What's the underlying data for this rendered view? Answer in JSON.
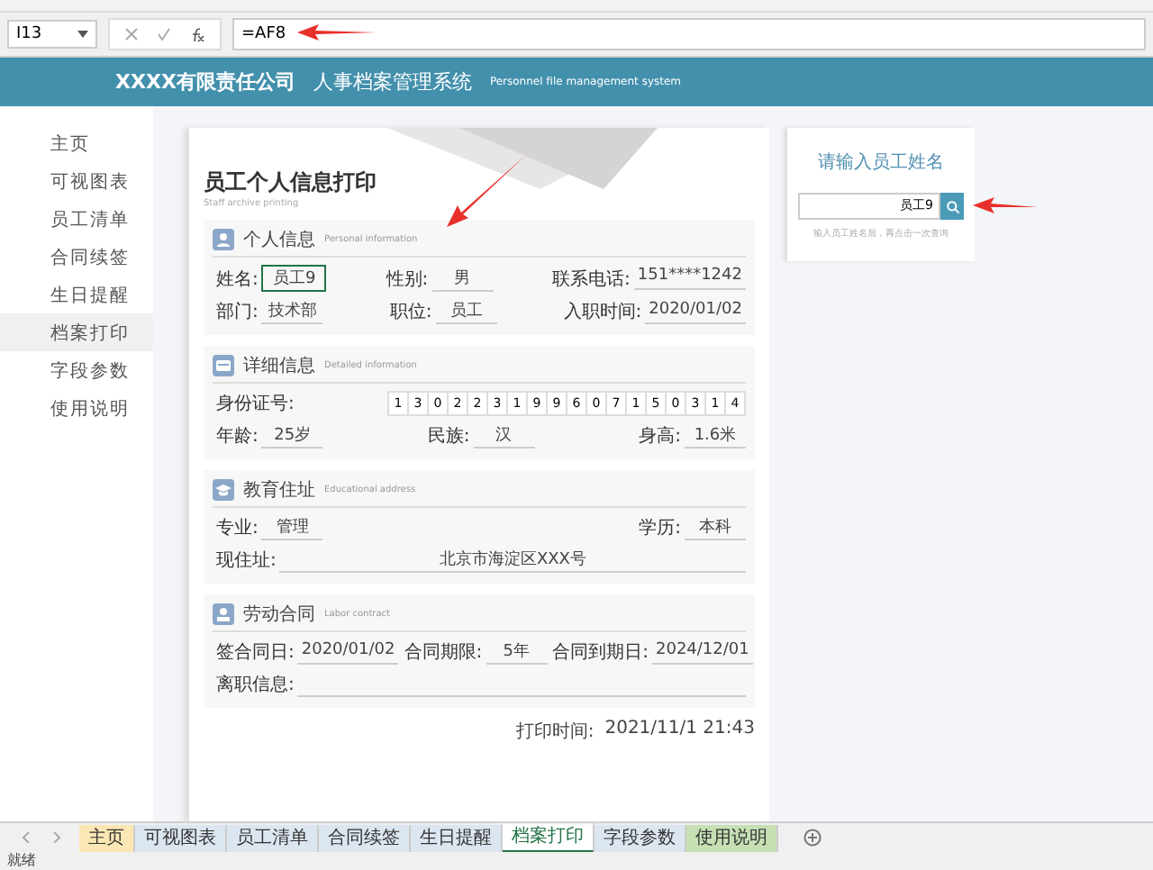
{
  "formula_bar": {
    "name_box": "I13",
    "formula": "=AF8"
  },
  "header": {
    "company": "XXXX有限责任公司",
    "system": "人事档案管理系统",
    "system_en": "Personnel file management system"
  },
  "sidebar": {
    "items": [
      {
        "label": "主页",
        "selected": false
      },
      {
        "label": "可视图表",
        "selected": false
      },
      {
        "label": "员工清单",
        "selected": false
      },
      {
        "label": "合同续签",
        "selected": false
      },
      {
        "label": "生日提醒",
        "selected": false
      },
      {
        "label": "档案打印",
        "selected": true
      },
      {
        "label": "字段参数",
        "selected": false
      },
      {
        "label": "使用说明",
        "selected": false
      }
    ]
  },
  "card": {
    "title": "员工个人信息打印",
    "subtitle": "Staff archive printing",
    "sections": [
      {
        "kind": "person",
        "title": "个人信息",
        "title_en": "Personal information",
        "rows": [
          {
            "kind": "fields",
            "fields": [
              {
                "label": "姓名:",
                "value": "员工9",
                "selected": true
              },
              {
                "label": "性别:",
                "value": "男",
                "selected": false
              },
              {
                "label": "联系电话:",
                "value": "151****1242",
                "selected": false
              }
            ]
          },
          {
            "kind": "fields",
            "fields": [
              {
                "label": "部门:",
                "value": "技术部",
                "selected": false
              },
              {
                "label": "职位:",
                "value": "员工",
                "selected": false
              },
              {
                "label": "入职时间:",
                "value": "2020/01/02",
                "selected": false
              }
            ]
          }
        ]
      },
      {
        "kind": "card",
        "title": "详细信息",
        "title_en": "Detailed information",
        "rows": [
          {
            "kind": "digits",
            "label": "身份证号:",
            "digits": [
              "1",
              "3",
              "0",
              "2",
              "2",
              "3",
              "1",
              "9",
              "9",
              "6",
              "0",
              "7",
              "1",
              "5",
              "0",
              "3",
              "1",
              "4"
            ]
          },
          {
            "kind": "fields",
            "fields": [
              {
                "label": "年龄:",
                "value": "25岁",
                "selected": false
              },
              {
                "label": "民族:",
                "value": "汉",
                "selected": false
              },
              {
                "label": "身高:",
                "value": "1.6米",
                "selected": false
              }
            ]
          }
        ]
      },
      {
        "kind": "school",
        "title": "教育住址",
        "title_en": "Educational address",
        "rows": [
          {
            "kind": "fields",
            "fields": [
              {
                "label": "专业:",
                "value": "管理",
                "selected": false
              },
              {
                "label": "学历:",
                "value": "本科",
                "selected": false
              }
            ]
          },
          {
            "kind": "fields",
            "fields": [
              {
                "label": "现住址:",
                "value": "北京市海淀区XXX号",
                "selected": false
              }
            ]
          }
        ]
      },
      {
        "kind": "contract",
        "title": "劳动合同",
        "title_en": "Labor contract",
        "rows": [
          {
            "kind": "fields",
            "fields": [
              {
                "label": "签合同日:",
                "value": "2020/01/02",
                "selected": false
              },
              {
                "label": "合同期限:",
                "value": "5年",
                "selected": false
              },
              {
                "label": "合同到期日:",
                "value": "2024/12/01",
                "selected": false
              }
            ]
          },
          {
            "kind": "fields",
            "fields": [
              {
                "label": "离职信息:"
              }
            ]
          }
        ]
      }
    ],
    "print_time_label": "打印时间:",
    "print_time": "2021/11/1 21:43"
  },
  "search_panel": {
    "title": "请输入员工姓名",
    "value": "员工9",
    "hint": "输入员工姓名后，再点击一次查询"
  },
  "sheet_tabs": [
    {
      "label": "主页",
      "selected": false,
      "color": "#fbe7b3"
    },
    {
      "label": "可视图表",
      "selected": false,
      "color": "#dce6f1"
    },
    {
      "label": "员工清单",
      "selected": false,
      "color": "#dce6f1"
    },
    {
      "label": "合同续签",
      "selected": false,
      "color": "#dce6f1"
    },
    {
      "label": "生日提醒",
      "selected": false,
      "color": "#dce6f1"
    },
    {
      "label": "档案打印",
      "selected": true,
      "color": "#ffffff"
    },
    {
      "label": "字段参数",
      "selected": false,
      "color": "#dce6f1"
    },
    {
      "label": "使用说明",
      "selected": false,
      "color": "#c6e0b4"
    }
  ],
  "status_bar": {
    "text": "就绪"
  }
}
